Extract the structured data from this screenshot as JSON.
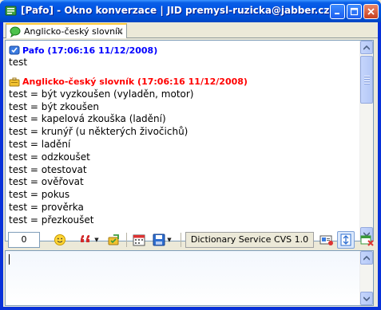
{
  "window": {
    "title": "[Pafo] - Okno konverzace | JID premysl-ruzicka@jabber.cz",
    "controls": [
      "minimize",
      "maximize",
      "close"
    ]
  },
  "tabs": [
    {
      "label": "Anglicko-český slovník",
      "icon": "chat-bubble-icon",
      "active": true
    }
  ],
  "chat": {
    "messages": [
      {
        "header": "Pafo (17:06:16 11/12/2008)",
        "header_color": "#0000ff",
        "icon": "user-verified-icon",
        "lines": [
          "test"
        ]
      },
      {
        "header": "Anglicko-český slovník (17:06:16 11/12/2008)",
        "header_color": "#ff0000",
        "icon": "briefcase-icon",
        "lines": [
          "test = být vyzkoušen (vyladěn, motor)",
          "test = být zkoušen",
          "test = kapelová zkouška (ladění)",
          "test = krunýř (u některých živočichů)",
          "test = ladění",
          "test = odzkoušet",
          "test = otestovat",
          "test = ověřovat",
          "test = pokus",
          "test = prověrka",
          "test = přezkoušet"
        ]
      }
    ]
  },
  "toolbar": {
    "counter_value": "0",
    "service_label": "Dictionary Service CVS 1.0",
    "buttons": [
      "emoticon-icon",
      "quote-icon",
      "user-action-icon",
      "calendar-icon",
      "save-icon",
      "card-icon",
      "scroll-lock-icon",
      "close-chat-icon"
    ]
  },
  "input": {
    "value": ""
  },
  "colors": {
    "title_bar": "#0054e3",
    "self_nick": "#0000ff",
    "other_nick": "#ff0000",
    "chrome": "#ece9d8"
  }
}
